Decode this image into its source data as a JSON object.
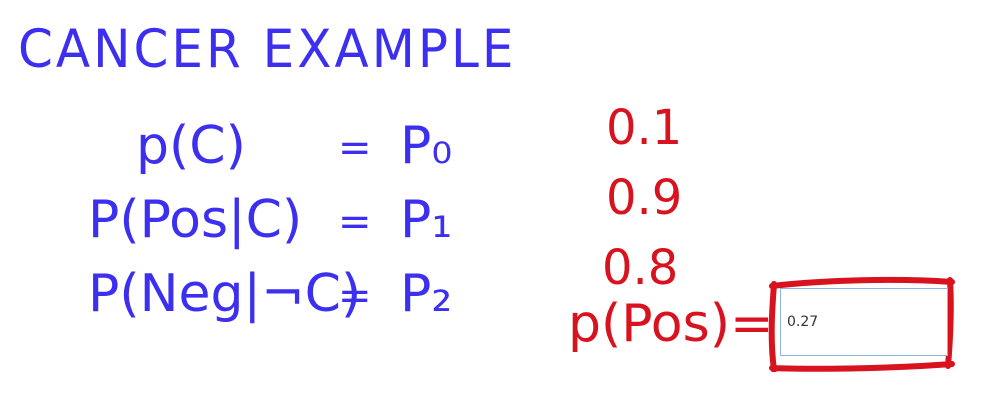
{
  "title": "CANCER EXAMPLE",
  "rows": [
    {
      "lhs": "p(C)",
      "eq": "=",
      "rhs": "P₀"
    },
    {
      "lhs": "P(Pos|C)",
      "eq": "=",
      "rhs": "P₁"
    },
    {
      "lhs": "P(Neg|¬C)",
      "eq": "=",
      "rhs": "P₂"
    }
  ],
  "values": [
    "0.1",
    "0.9",
    "0.8"
  ],
  "answer": {
    "label": "p(Pos)=",
    "value": "0.27"
  },
  "colors": {
    "ink_blue": "#3c2ff0",
    "ink_red": "#d8121e",
    "input_border": "#8fb3e0"
  }
}
